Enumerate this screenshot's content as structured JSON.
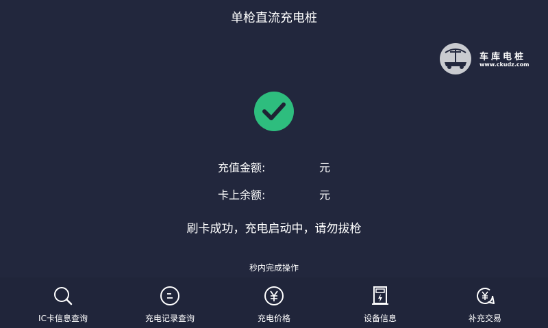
{
  "header": {
    "title": "单枪直流充电桩"
  },
  "watermark": {
    "name": "车库电桩",
    "url": "www.ckudz.com"
  },
  "status": {
    "icon": "check-circle-icon",
    "color": "#2ebd7e",
    "recharge_label": "充值金额:",
    "recharge_value": "元",
    "balance_label": "卡上余额:",
    "balance_value": "元",
    "message": "刷卡成功，充电启动中，请勿拔枪",
    "countdown": "秒内完成操作"
  },
  "nav": {
    "items": [
      {
        "label": "IC卡信息查询",
        "icon": "search-icon"
      },
      {
        "label": "充电记录查询",
        "icon": "record-icon"
      },
      {
        "label": "充电价格",
        "icon": "yen-icon"
      },
      {
        "label": "设备信息",
        "icon": "charger-icon"
      },
      {
        "label": "补充交易",
        "icon": "refresh-yen-icon"
      }
    ]
  }
}
